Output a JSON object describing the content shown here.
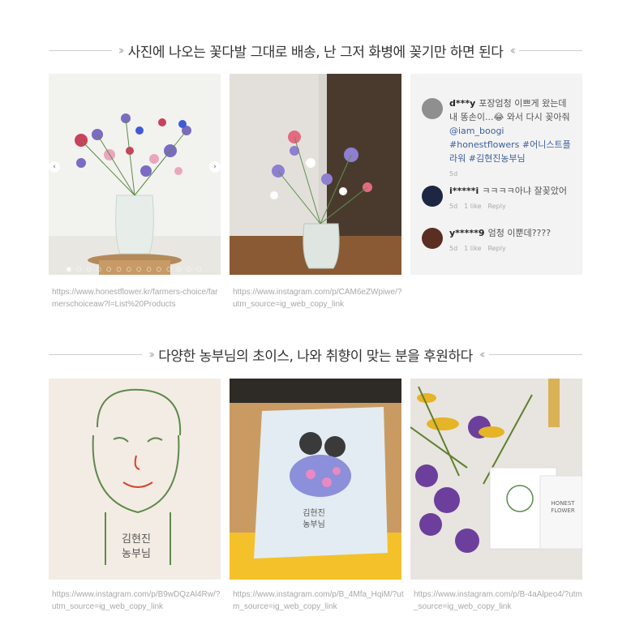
{
  "section1": {
    "title": "사진에 나오는 꽃다발 그대로 배송, 난 그저 화병에 꽂기만 하면 된다",
    "captions": [
      "https://www.honestflower.kr/farmers-choice/farmerschoiceaw?l=List%20Products",
      "https://www.instagram.com/p/CAM6eZWpiwe/?utm_source=ig_web_copy_link"
    ],
    "comments": [
      {
        "user": "d***y",
        "text": "포장엄청 이쁘게 왔는데 내 똥손이...😂 와서 다시 꽂아줘 ",
        "mention": "@iam_boogi",
        "tags": "#honestflowers #어니스트플라워 #김현진농부님",
        "time": "5d",
        "likes": "",
        "reply": ""
      },
      {
        "user": "i*****i",
        "text": "ㅋㅋㅋㅋ아냐 잘꽂았어",
        "mention": "",
        "tags": "",
        "time": "5d",
        "likes": "1 like",
        "reply": "Reply"
      },
      {
        "user": "y*****9",
        "text": "엄청 이뿐데????",
        "mention": "",
        "tags": "",
        "time": "5d",
        "likes": "1 like",
        "reply": "Reply"
      }
    ]
  },
  "section2": {
    "title": "다양한 농부님의 초이스, 나와 취향이 맞는 분을 후원하다",
    "captions": [
      "https://www.instagram.com/p/B9wDQzAl4Rw/?utm_source=ig_web_copy_link",
      "https://www.instagram.com/p/B_4Mfa_HqiM/?utm_source=ig_web_copy_link",
      "https://www.instagram.com/p/B-4aAlpeo4/?utm_source=ig_web_copy_link"
    ],
    "card_text": {
      "farmer_name": "김현진\n농부님",
      "box_text": "김현진\n농부님",
      "brand": "HONEST\nFLOWER"
    }
  },
  "icons": {
    "prev": "chevron-left-icon",
    "next": "chevron-right-icon",
    "heading_chevron": "double-chevron-icon"
  },
  "colors": {
    "panel": "#f3f3f3",
    "link": "#3b5f9a",
    "caption": "#a8a8a8"
  }
}
